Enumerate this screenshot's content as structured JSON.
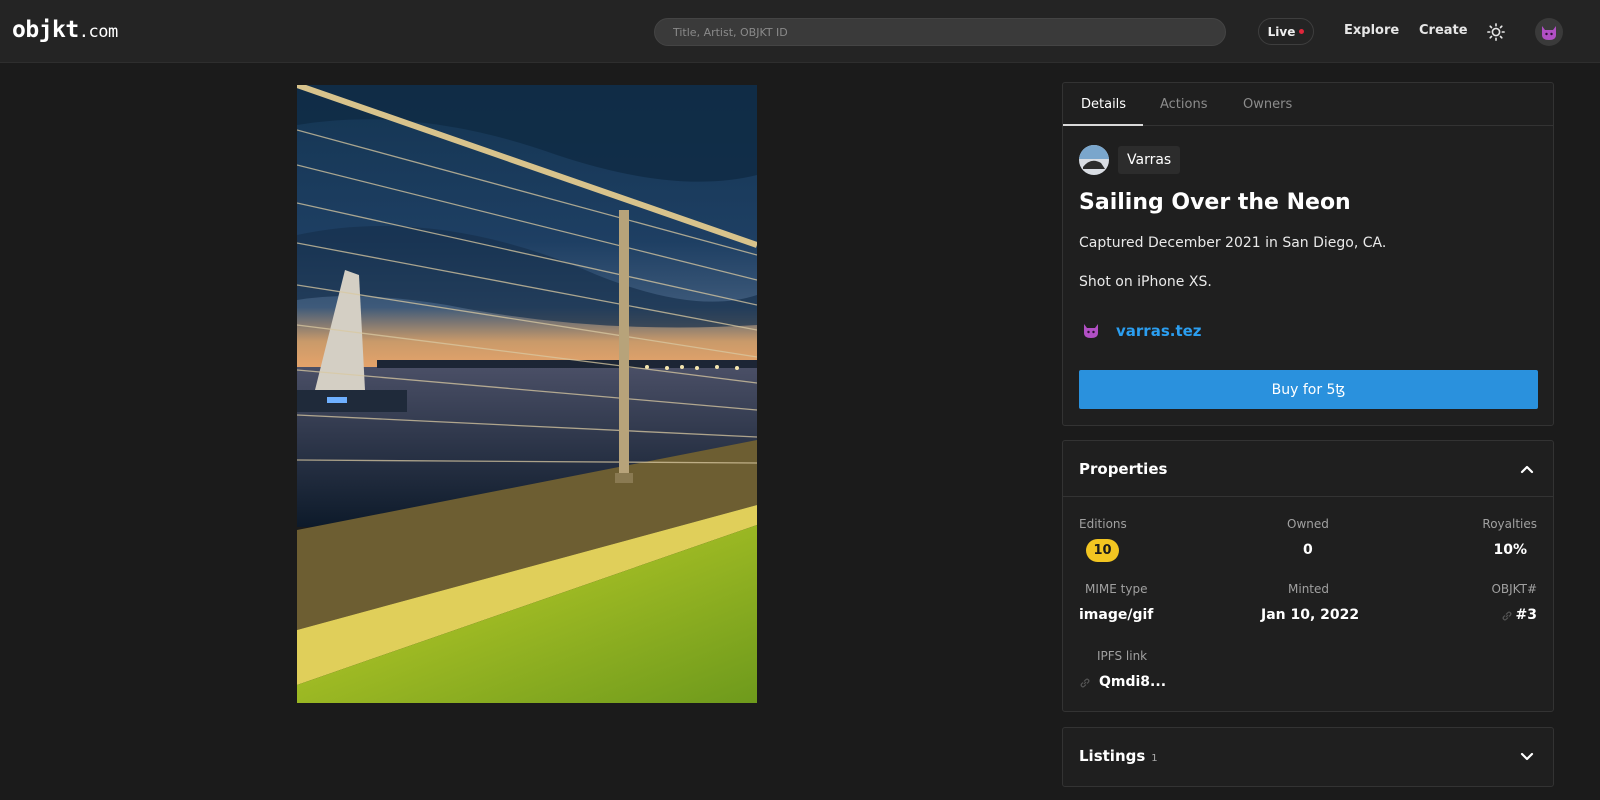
{
  "header": {
    "logo_main": "objkt",
    "logo_domain": ".com",
    "search_placeholder": "Title, Artist, OBJKT ID",
    "live_label": "Live",
    "nav": {
      "explore": "Explore",
      "create": "Create"
    }
  },
  "details": {
    "tabs": [
      "Details",
      "Actions",
      "Owners"
    ],
    "creator": "Varras",
    "title": "Sailing Over the Neon",
    "description": [
      "Captured December 2021 in San Diego, CA.",
      "Shot on iPhone XS."
    ],
    "owner": "varras.tez",
    "buy_label": "Buy for 5ꜩ"
  },
  "properties": {
    "title": "Properties",
    "editions_label": "Editions",
    "editions_value": "10",
    "owned_label": "Owned",
    "owned_value": "0",
    "royalties_label": "Royalties",
    "royalties_value": "10%",
    "mime_label": "MIME type",
    "mime_value": "image/gif",
    "minted_label": "Minted",
    "minted_value": "Jan 10, 2022",
    "objkt_label": "OBJKT#",
    "objkt_value": "#3",
    "ipfs_label": "IPFS link",
    "ipfs_value": "Qmdi8..."
  },
  "listings": {
    "title": "Listings",
    "count": "1"
  },
  "colors": {
    "accent": "#2a91dd",
    "link": "#2b9ef0",
    "badge": "#f2c521",
    "live_dot": "#e0263b"
  }
}
